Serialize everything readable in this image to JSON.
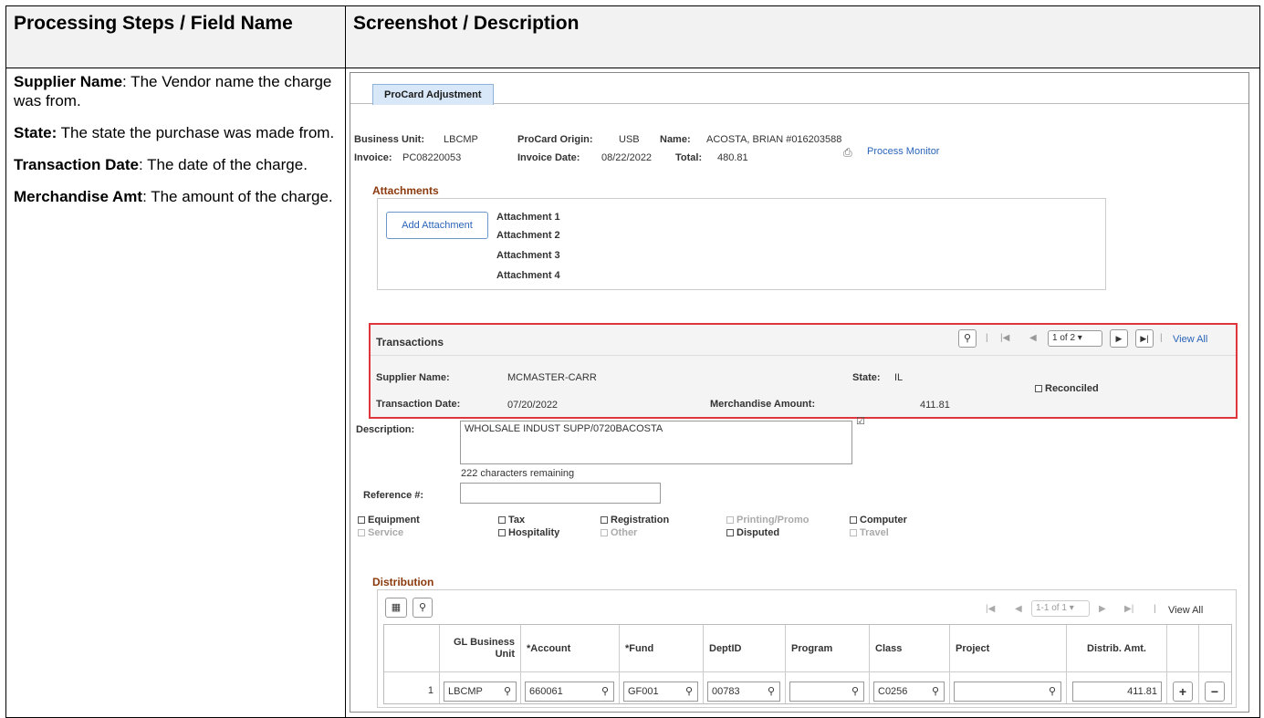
{
  "doc": {
    "col1_header": "Processing Steps / Field Name",
    "col2_header": "Screenshot / Description",
    "steps": [
      {
        "term": "Supplier Name",
        "desc": ":  The Vendor name the charge was from."
      },
      {
        "term": "State:",
        "desc": " The state the purchase was made from."
      },
      {
        "term": "Transaction Date",
        "desc": ":  The date of the charge."
      },
      {
        "term": "Merchandise Amt",
        "desc": ":  The amount of the charge."
      }
    ]
  },
  "screen": {
    "tab_label": "ProCard Adjustment",
    "header": {
      "bu_label": "Business Unit:",
      "bu_value": "LBCMP",
      "origin_label": "ProCard Origin:",
      "origin_value": "USB",
      "name_label": "Name:",
      "name_value": "ACOSTA, BRIAN  #016203588",
      "invoice_label": "Invoice:",
      "invoice_value": "PC08220053",
      "invdate_label": "Invoice Date:",
      "invdate_value": "08/22/2022",
      "total_label": "Total:",
      "total_value": "480.81",
      "process_monitor": "Process Monitor"
    },
    "attachments": {
      "title": "Attachments",
      "add_button": "Add Attachment",
      "items": [
        "Attachment 1",
        "Attachment 2",
        "Attachment 3",
        "Attachment 4"
      ]
    },
    "transactions": {
      "title": "Transactions",
      "pager": "1 of 2",
      "view_all": "View All",
      "supplier_label": "Supplier Name:",
      "supplier_value": "MCMASTER-CARR",
      "state_label": "State:",
      "state_value": "IL",
      "reconciled_label": "Reconciled",
      "txdate_label": "Transaction Date:",
      "txdate_value": "07/20/2022",
      "merch_label": "Merchandise Amount:",
      "merch_value": "411.81"
    },
    "details": {
      "description_label": "Description:",
      "description_value": "WHOLSALE INDUST SUPP/0720BACOSTA",
      "chars_remaining": "222 characters remaining",
      "reference_label": "Reference #:",
      "reference_value": "",
      "checkboxes": [
        {
          "label": "Equipment",
          "enabled": true
        },
        {
          "label": "Tax",
          "enabled": true
        },
        {
          "label": "Registration",
          "enabled": true
        },
        {
          "label": "Printing/Promo",
          "enabled": false
        },
        {
          "label": "Computer",
          "enabled": true
        },
        {
          "label": "Service",
          "enabled": false
        },
        {
          "label": "Hospitality",
          "enabled": true
        },
        {
          "label": "Other",
          "enabled": false
        },
        {
          "label": "Disputed",
          "enabled": true
        },
        {
          "label": "Travel",
          "enabled": false
        }
      ]
    },
    "distribution": {
      "title": "Distribution",
      "pager": "1-1 of 1",
      "view_all": "View All",
      "columns": [
        "",
        "GL Business Unit",
        "*Account",
        "*Fund",
        "DeptID",
        "Program",
        "Class",
        "Project",
        "Distrib. Amt.",
        "",
        ""
      ],
      "row": {
        "num": "1",
        "gl_bu": "LBCMP",
        "account": "660061",
        "fund": "GF001",
        "deptid": "00783",
        "program": "",
        "class": "C0256",
        "project": "",
        "amount": "411.81"
      }
    }
  }
}
